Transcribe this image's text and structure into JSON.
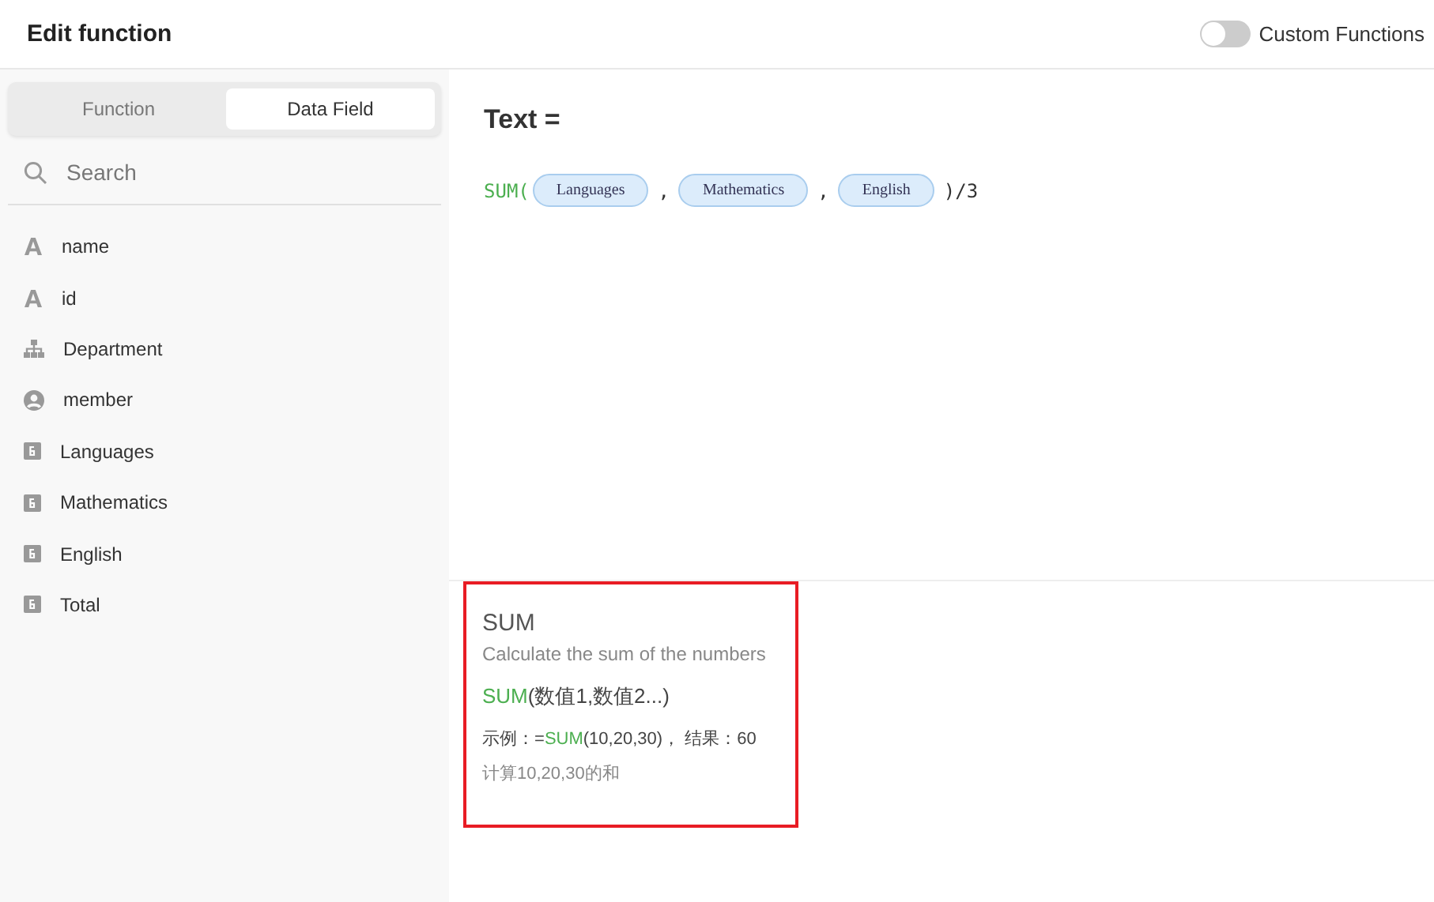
{
  "header": {
    "title": "Edit function",
    "toggle": {
      "label": "Custom Functions",
      "on": false
    }
  },
  "sidebar": {
    "tabs": [
      {
        "label": "Function",
        "selected": false
      },
      {
        "label": "Data Field",
        "selected": true
      }
    ],
    "search": {
      "placeholder": "Search"
    },
    "fields": [
      {
        "kind": "text",
        "label": "name"
      },
      {
        "kind": "text",
        "label": "id"
      },
      {
        "kind": "org",
        "label": "Department"
      },
      {
        "kind": "member",
        "label": "member"
      },
      {
        "kind": "number",
        "label": "Languages"
      },
      {
        "kind": "number",
        "label": "Mathematics"
      },
      {
        "kind": "number",
        "label": "English"
      },
      {
        "kind": "number",
        "label": "Total"
      }
    ]
  },
  "editor": {
    "title": "Text =",
    "formula": [
      {
        "kind": "fn",
        "text": "SUM("
      },
      {
        "kind": "field",
        "text": "Languages"
      },
      {
        "kind": "text",
        "text": ","
      },
      {
        "kind": "field",
        "text": "Mathematics"
      },
      {
        "kind": "text",
        "text": ","
      },
      {
        "kind": "field",
        "text": "English"
      },
      {
        "kind": "text",
        "text": ")/3"
      }
    ]
  },
  "doc": {
    "name": "SUM",
    "description": "Calculate the sum of the numbers",
    "syntax": [
      {
        "kind": "fn",
        "text": "SUM"
      },
      {
        "kind": "text",
        "text": "(数值1,数值2...)"
      }
    ],
    "example": [
      {
        "kind": "text",
        "text": "示例：="
      },
      {
        "kind": "fn",
        "text": "SUM"
      },
      {
        "kind": "text",
        "text": "(10,20,30)， 结果：60"
      }
    ],
    "note": "计算10,20,30的和"
  }
}
